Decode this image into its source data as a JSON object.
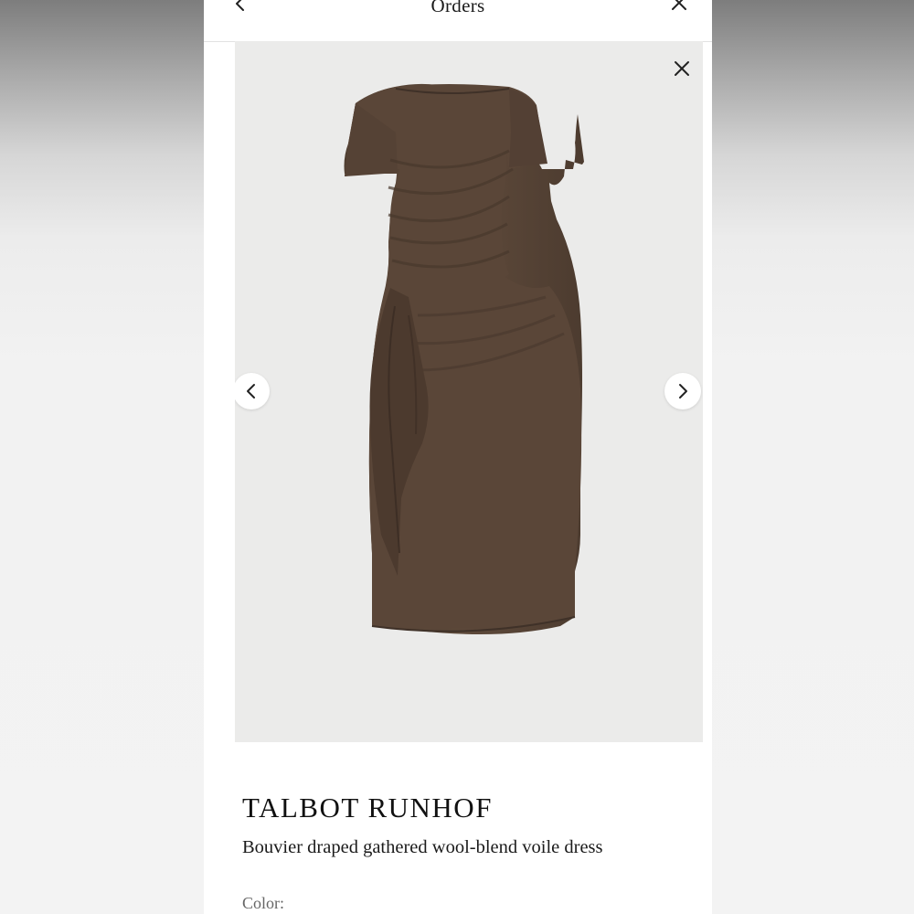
{
  "header": {
    "title": "Orders"
  },
  "icons": {
    "back": "chevron-left-icon",
    "close": "close-icon",
    "image_close": "close-icon",
    "prev": "chevron-left-icon",
    "next": "chevron-right-icon"
  },
  "product": {
    "brand": "TALBOT RUNHOF",
    "name": "Bouvier draped gathered wool-blend voile dress",
    "color_label": "Color:"
  },
  "colors": {
    "dress": "#5a4638",
    "image_background": "#ebebea",
    "text": "#111111"
  }
}
